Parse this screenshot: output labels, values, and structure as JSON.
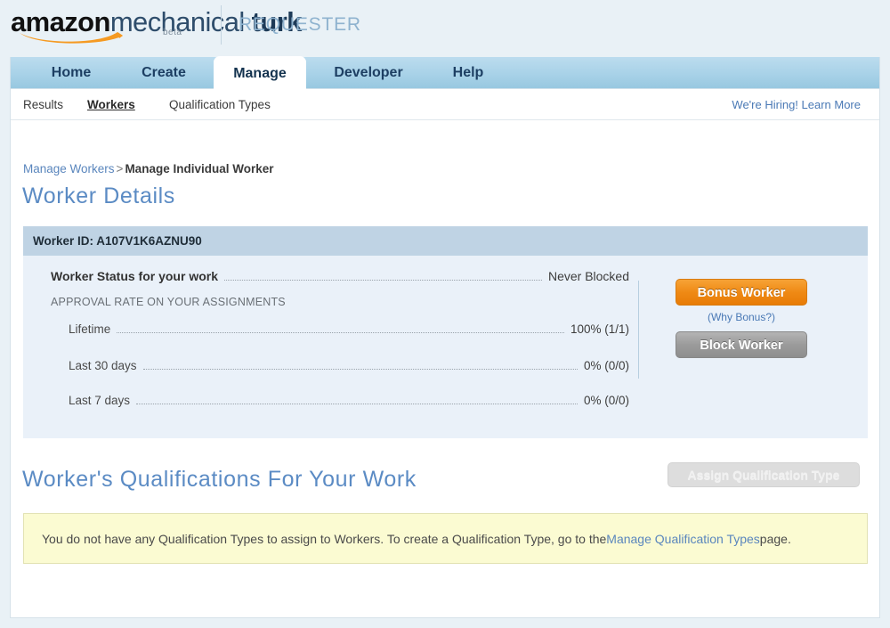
{
  "brand": {
    "amazon": "amazon",
    "mechanical": "mechanical",
    "turk": " turk",
    "beta": "beta",
    "requester": "REQUESTER"
  },
  "tabs": [
    {
      "label": "Home",
      "active": false
    },
    {
      "label": "Create",
      "active": false
    },
    {
      "label": "Manage",
      "active": true
    },
    {
      "label": "Developer",
      "active": false
    },
    {
      "label": "Help",
      "active": false
    }
  ],
  "subnav": {
    "items": [
      {
        "label": "Results",
        "selected": false
      },
      {
        "label": "Workers",
        "selected": true
      },
      {
        "label": "Qualification Types",
        "selected": false
      }
    ],
    "hiring_link": "We're Hiring! Learn More"
  },
  "breadcrumb": {
    "parent": "Manage Workers",
    "separator": ">",
    "current": "Manage Individual Worker"
  },
  "page_title": "Worker Details",
  "worker": {
    "id_label": "Worker ID: A107V1K6AZNU90",
    "status_label": "Worker Status for your work",
    "status_value": "Never Blocked",
    "approval_heading": "APPROVAL RATE ON YOUR ASSIGNMENTS",
    "rates": [
      {
        "label": "Lifetime",
        "value": "100% (1/1)"
      },
      {
        "label": "Last 30 days",
        "value": "0% (0/0)"
      },
      {
        "label": "Last 7 days",
        "value": "0% (0/0)"
      }
    ],
    "bonus_button": "Bonus Worker",
    "why_bonus_link": "(Why Bonus?)",
    "block_button": "Block Worker"
  },
  "qualifications": {
    "title": "Worker's Qualifications For Your Work",
    "assign_button": "Assign Qualification Type",
    "notice_before": "You do not have any Qualification Types to assign to Workers. To create a Qualification Type, go to the ",
    "notice_link": "Manage Qualification Types",
    "notice_after": " page."
  },
  "colors": {
    "page_background": "#e9f1f6",
    "tabbar_blue": "#a8d2e8",
    "worker_head": "#bfd3e4",
    "worker_body": "#eaf1f9",
    "title_blue": "#5b8bc4",
    "link_blue": "#5a86bd",
    "bonus_orange": "#ef8a15",
    "block_gray": "#9b9b9b",
    "notice_yellow": "#fbfbd2"
  }
}
